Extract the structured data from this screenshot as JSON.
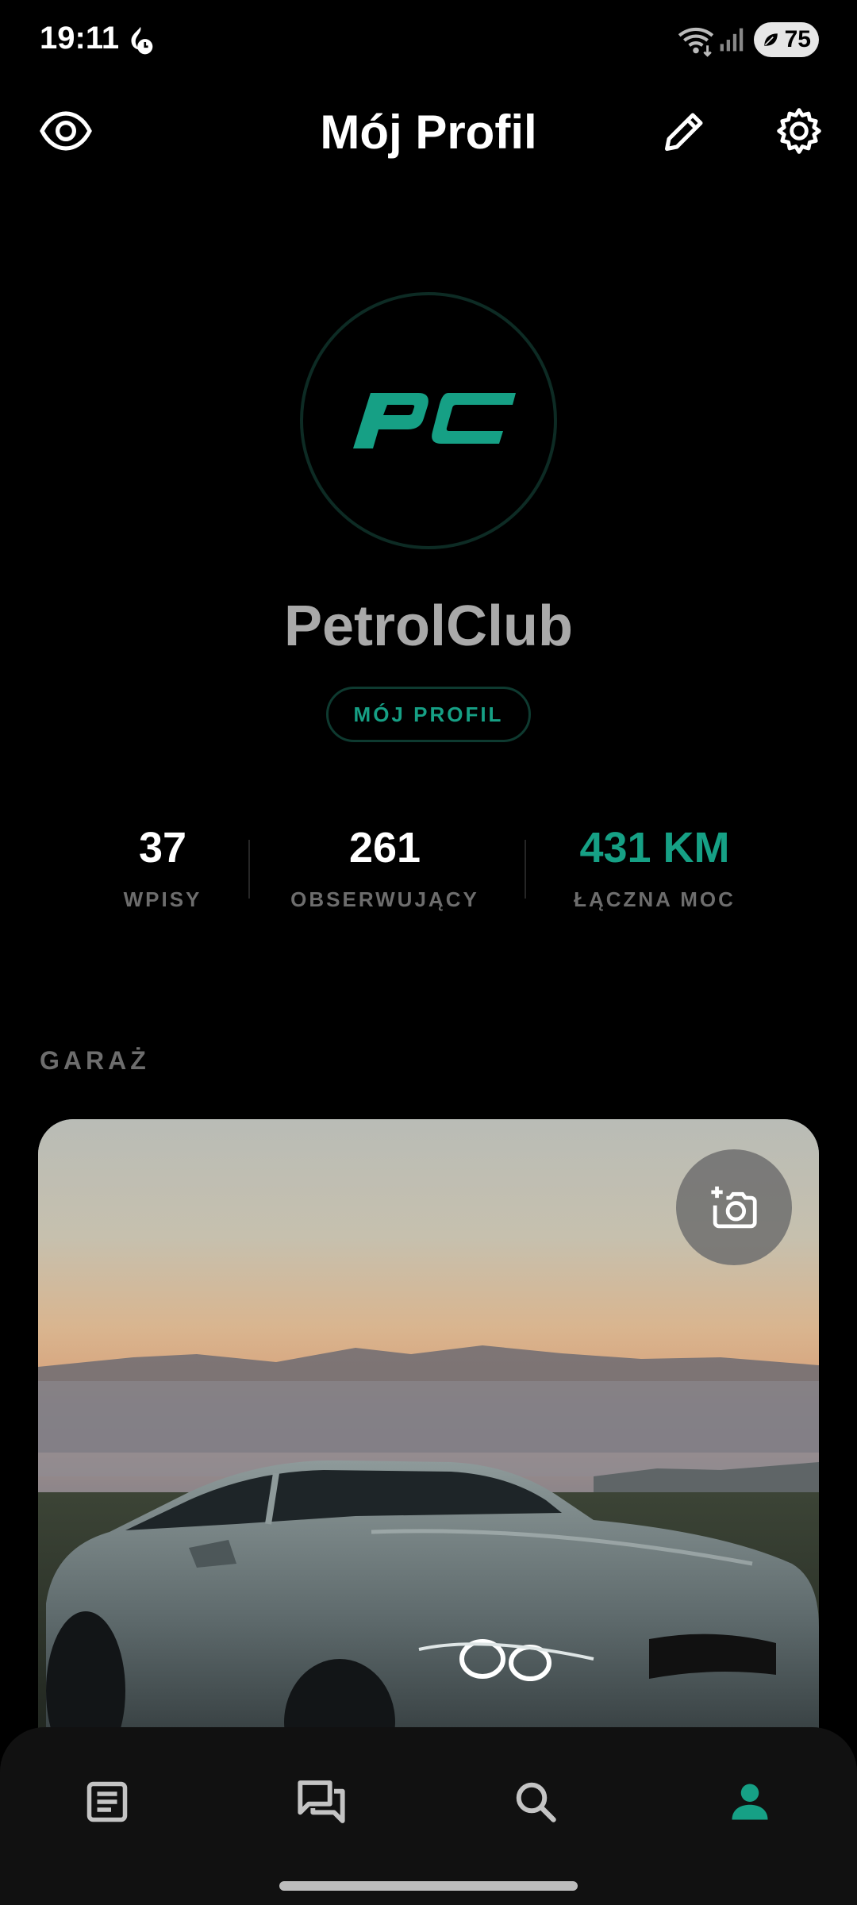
{
  "status_bar": {
    "time": "19:11",
    "battery": "75",
    "icons": [
      "flame-icon",
      "wifi-icon",
      "signal-icon",
      "battery-icon"
    ]
  },
  "header": {
    "title": "Mój Profil",
    "icons": [
      "eye-icon",
      "pencil-icon",
      "gear-icon"
    ]
  },
  "profile": {
    "avatar_logo": "PC",
    "name": "PetrolClub",
    "chip_label": "MÓJ PROFIL"
  },
  "stats": {
    "posts": {
      "value": "37",
      "label": "WPISY"
    },
    "followers": {
      "value": "261",
      "label": "OBSERWUJĄCY"
    },
    "power": {
      "value": "431 KM",
      "label": "ŁĄCZNA MOC"
    }
  },
  "garage": {
    "section_title": "GARAŻ",
    "add_photo_icon": "add-photo-icon"
  },
  "bottom_nav": {
    "items": [
      "feed-icon",
      "chat-icon",
      "search-icon",
      "profile-icon"
    ],
    "active": "profile-icon"
  },
  "colors": {
    "accent": "#16a085",
    "background": "#000000",
    "nav_background": "#111111",
    "muted_label": "#6d6d6d",
    "name_text": "#a9a9a9"
  }
}
